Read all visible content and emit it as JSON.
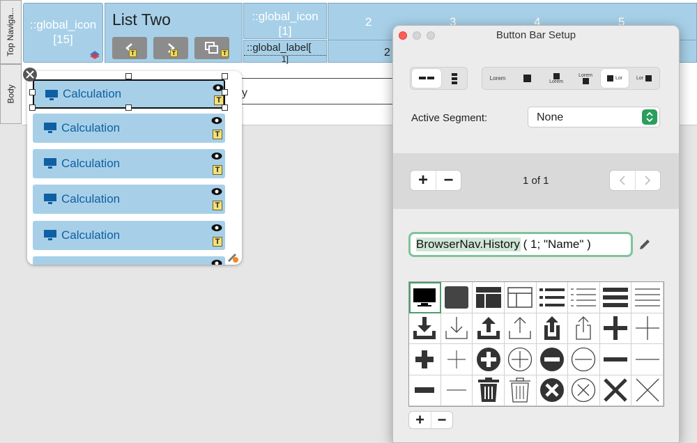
{
  "parts": {
    "top_nav": "Top Naviga...",
    "body": "Body"
  },
  "topnav": {
    "global_icon_label": "::global_icon",
    "global_icon_index": "[15]",
    "list_title": "List Two",
    "col_global_icon": "::global_icon",
    "col_global_icon_index": "[1]",
    "col_global_label": "::global_label[",
    "col_global_label_index": "1]",
    "col_value": "2",
    "column_numbers": [
      "2",
      "3",
      "4",
      "5"
    ]
  },
  "body_row_fragment": "y",
  "popover": {
    "rows": [
      {
        "label": "Calculation",
        "badge": "T"
      },
      {
        "label": "Calculation",
        "badge": "T"
      },
      {
        "label": "Calculation",
        "badge": "T"
      },
      {
        "label": "Calculation",
        "badge": "T"
      },
      {
        "label": "Calculation",
        "badge": "T"
      }
    ]
  },
  "dialog": {
    "title": "Button Bar Setup",
    "style_options": [
      "Lorem",
      "Lorem",
      "Lorem",
      "Lor",
      "Lor"
    ],
    "active_segment_label": "Active Segment:",
    "active_segment_value": "None",
    "add_label": "+",
    "remove_label": "−",
    "pagination": "1 of 1",
    "calc_text": "BrowserNav.History ( 1; \"Name\" )",
    "icon_names": [
      "monitor-icon",
      "square-icon",
      "layout-icon",
      "layout-outline-icon",
      "list-icon",
      "list-outline-icon",
      "menu-icon",
      "menu-outline-icon",
      "download-icon",
      "download-outline-icon",
      "upload-icon",
      "upload-outline-icon",
      "share-icon",
      "share-outline-icon",
      "plus-icon",
      "plus-thin-icon",
      "plus-bold-icon",
      "plus-light-icon",
      "plus-circle-icon",
      "plus-circle-outline-icon",
      "minus-circle-icon",
      "minus-circle-outline-icon",
      "minus-icon",
      "minus-thin-icon",
      "minus-bold-icon",
      "minus-light-icon",
      "trash-icon",
      "trash-outline-icon",
      "close-circle-icon",
      "close-circle-outline-icon",
      "close-icon",
      "close-thin-icon"
    ]
  },
  "colors": {
    "accent_green": "#4d9e6b",
    "cell_blue": "#a7d0e8",
    "label_blue": "#0f5fa3"
  }
}
